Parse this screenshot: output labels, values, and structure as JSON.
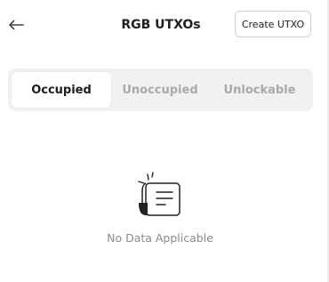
{
  "header": {
    "title": "RGB UTXOs",
    "back_icon": "arrow-left-icon",
    "create_button_label": "Create UTXO"
  },
  "tabs": [
    {
      "label": "Occupied",
      "active": true
    },
    {
      "label": "Unoccupied",
      "active": false
    },
    {
      "label": "Unlockable",
      "active": false
    }
  ],
  "empty_state": {
    "icon": "empty-document-icon",
    "message": "No Data Applicable"
  },
  "colors": {
    "tab_track": "#f1f1f1",
    "active_tab_text": "#1d1d1d",
    "inactive_tab_text": "#a9a9a9",
    "empty_text": "#8a8a8a"
  }
}
